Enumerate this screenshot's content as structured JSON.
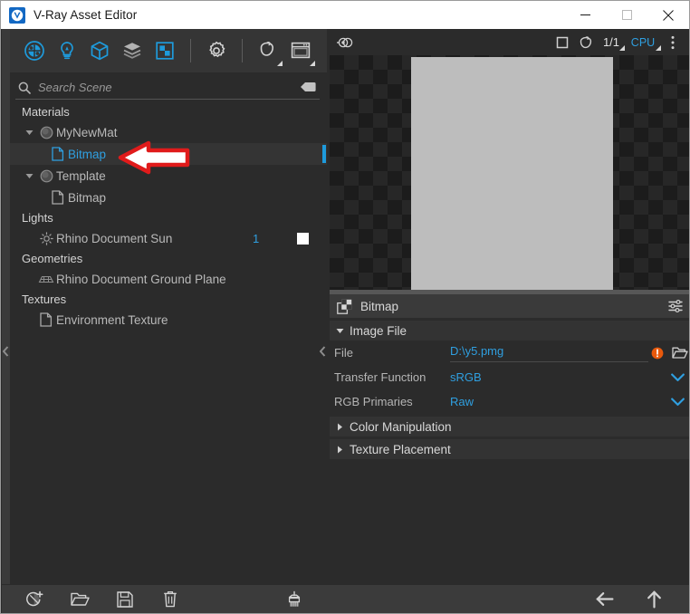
{
  "window": {
    "title": "V-Ray Asset Editor",
    "app_icon": "vray-logo-icon",
    "minimize_label": "Minimize",
    "maximize_label": "Maximize",
    "close_label": "Close"
  },
  "toolbar": {
    "items": [
      {
        "name": "materials-tab-icon",
        "label": "Materials",
        "active": true
      },
      {
        "name": "lights-tab-icon",
        "label": "Lights",
        "active": true
      },
      {
        "name": "geometry-tab-icon",
        "label": "Geometry",
        "active": true
      },
      {
        "name": "render-elements-tab-icon",
        "label": "Render Elements",
        "active": false
      },
      {
        "name": "textures-tab-icon",
        "label": "Textures",
        "active": true
      },
      {
        "name": "settings-tab-icon",
        "label": "Settings",
        "active": false
      },
      {
        "name": "material-preview-icon",
        "label": "Material Preview",
        "active": false
      },
      {
        "name": "render-view-icon",
        "label": "Render View",
        "active": false
      }
    ]
  },
  "search": {
    "placeholder": "Search Scene",
    "value": "",
    "icon": "search-icon",
    "clear_icon": "clear-search-icon"
  },
  "tree": {
    "groups": [
      {
        "label": "Materials",
        "items": [
          {
            "label": "MyNewMat",
            "icon": "material-sphere-icon",
            "indent": 1,
            "expanded": true,
            "selected": false,
            "blue": false
          },
          {
            "label": "Bitmap",
            "icon": "texture-file-icon",
            "indent": 2,
            "expanded": null,
            "selected": true,
            "blue": true
          },
          {
            "label": "Template",
            "icon": "material-sphere-icon",
            "indent": 1,
            "expanded": true,
            "selected": false,
            "blue": false
          },
          {
            "label": "Bitmap",
            "icon": "texture-file-icon",
            "indent": 2,
            "expanded": null,
            "selected": false,
            "blue": false
          }
        ]
      },
      {
        "label": "Lights",
        "items": [
          {
            "label": "Rhino Document Sun",
            "icon": "sun-icon",
            "indent": 1,
            "expanded": null,
            "selected": false,
            "blue": false,
            "count": "1",
            "swatch": "#ffffff"
          }
        ]
      },
      {
        "label": "Geometries",
        "items": [
          {
            "label": "Rhino Document Ground Plane",
            "icon": "ground-plane-icon",
            "indent": 1,
            "expanded": null,
            "selected": false,
            "blue": false
          }
        ]
      },
      {
        "label": "Textures",
        "items": [
          {
            "label": "Environment Texture",
            "icon": "texture-file-icon",
            "indent": 1,
            "expanded": null,
            "selected": false,
            "blue": false
          }
        ]
      }
    ]
  },
  "annotation": {
    "shape": "left-pointing-arrow",
    "color": "#e01b1b"
  },
  "preview_header": {
    "left_icon": "render-interactive-icon",
    "buttons": [
      {
        "name": "preview-shape-box-icon",
        "label": "Box"
      },
      {
        "name": "preview-shape-teapot-icon",
        "label": "Teapot"
      }
    ],
    "quality_fraction": "1/1",
    "engine": "CPU"
  },
  "preview": {
    "background": "checkerboard",
    "image_color": "#bdbdbd"
  },
  "properties": {
    "title": "Bitmap",
    "title_icon": "bitmap-icon",
    "options_icon": "sliders-icon",
    "sections": [
      {
        "label": "Image File",
        "expanded": true,
        "rows": [
          {
            "label": "File",
            "value": "D:\\y5.pmg",
            "type": "file",
            "warning_icon": "warning-icon",
            "browse_icon": "folder-open-icon"
          },
          {
            "label": "Transfer Function",
            "value": "sRGB",
            "type": "dropdown",
            "chevron_icon": "chevron-down-icon"
          },
          {
            "label": "RGB Primaries",
            "value": "Raw",
            "type": "dropdown",
            "chevron_icon": "chevron-down-icon"
          }
        ]
      },
      {
        "label": "Color Manipulation",
        "expanded": false,
        "rows": []
      },
      {
        "label": "Texture Placement",
        "expanded": false,
        "rows": []
      }
    ]
  },
  "bottombar": {
    "left_buttons": [
      {
        "name": "add-asset-button",
        "icon": "sphere-plus-icon",
        "label": "Add Asset"
      },
      {
        "name": "open-file-button",
        "icon": "folder-open-icon",
        "label": "Open"
      },
      {
        "name": "save-file-button",
        "icon": "floppy-disk-icon",
        "label": "Save"
      },
      {
        "name": "delete-asset-button",
        "icon": "trash-icon",
        "label": "Delete"
      }
    ],
    "center_buttons": [
      {
        "name": "purge-button",
        "icon": "broom-icon",
        "label": "Purge Unused Assets"
      }
    ],
    "right_buttons": [
      {
        "name": "back-button",
        "icon": "arrow-left-icon",
        "label": "Back"
      },
      {
        "name": "up-button",
        "icon": "arrow-up-icon",
        "label": "Up"
      }
    ]
  },
  "colors": {
    "accent": "#2f9fe0",
    "selection_bar": "#1e9bdc",
    "warning": "#e8590c",
    "annotation": "#e01b1b"
  }
}
